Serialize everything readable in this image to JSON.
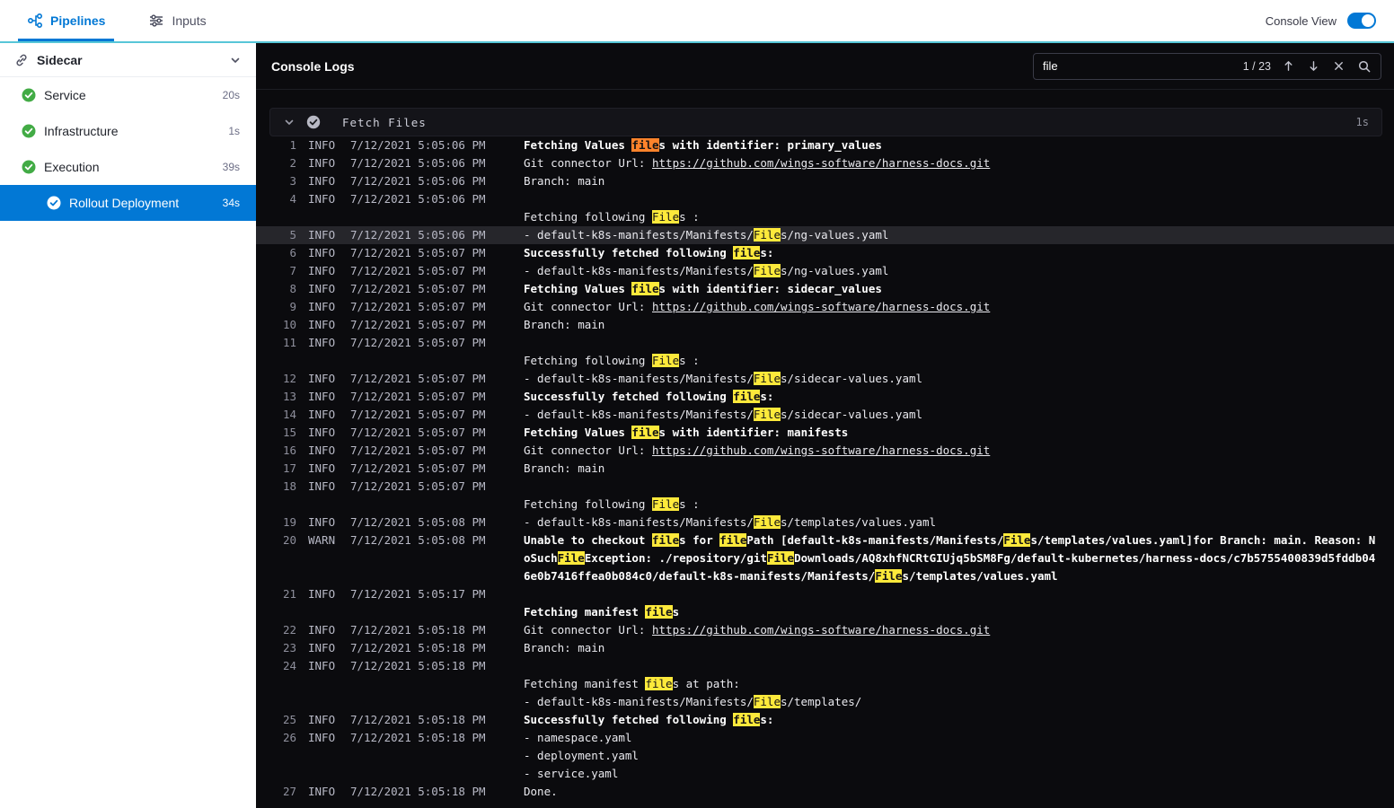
{
  "topbar": {
    "tabs": [
      {
        "label": "Pipelines",
        "active": true
      },
      {
        "label": "Inputs",
        "active": false
      }
    ],
    "console_view_label": "Console View",
    "console_view_on": true
  },
  "sidebar": {
    "stage": {
      "label": "Sidecar"
    },
    "items": [
      {
        "label": "Service",
        "duration": "20s",
        "status": "success",
        "selected": false,
        "child": false
      },
      {
        "label": "Infrastructure",
        "duration": "1s",
        "status": "success",
        "selected": false,
        "child": false
      },
      {
        "label": "Execution",
        "duration": "39s",
        "status": "success",
        "selected": false,
        "child": false
      },
      {
        "label": "Rollout Deployment",
        "duration": "34s",
        "status": "success",
        "selected": true,
        "child": true
      }
    ]
  },
  "console": {
    "title": "Console Logs",
    "search": {
      "term": "file",
      "count_label": "1 / 23"
    },
    "section": {
      "title": "Fetch Files",
      "duration": "1s"
    },
    "lines": [
      {
        "num": "1",
        "level": "INFO",
        "time": "7/12/2021 5:05:06 PM",
        "text": "Fetching Values files with identifier: primary_values",
        "bold": true
      },
      {
        "num": "2",
        "level": "INFO",
        "time": "7/12/2021 5:05:06 PM",
        "text": "Git connector Url: https://github.com/wings-software/harness-docs.git"
      },
      {
        "num": "3",
        "level": "INFO",
        "time": "7/12/2021 5:05:06 PM",
        "text": "Branch: main"
      },
      {
        "num": "4",
        "level": "INFO",
        "time": "7/12/2021 5:05:06 PM",
        "text": ""
      },
      {
        "num": "",
        "level": "",
        "time": "",
        "text": "Fetching following Files :"
      },
      {
        "num": "5",
        "level": "INFO",
        "time": "7/12/2021 5:05:06 PM",
        "text": "- default-k8s-manifests/Manifests/Files/ng-values.yaml",
        "selected": true
      },
      {
        "num": "6",
        "level": "INFO",
        "time": "7/12/2021 5:05:07 PM",
        "text": "Successfully fetched following files:",
        "bold": true
      },
      {
        "num": "7",
        "level": "INFO",
        "time": "7/12/2021 5:05:07 PM",
        "text": "- default-k8s-manifests/Manifests/Files/ng-values.yaml"
      },
      {
        "num": "8",
        "level": "INFO",
        "time": "7/12/2021 5:05:07 PM",
        "text": "Fetching Values files with identifier: sidecar_values",
        "bold": true
      },
      {
        "num": "9",
        "level": "INFO",
        "time": "7/12/2021 5:05:07 PM",
        "text": "Git connector Url: https://github.com/wings-software/harness-docs.git"
      },
      {
        "num": "10",
        "level": "INFO",
        "time": "7/12/2021 5:05:07 PM",
        "text": "Branch: main"
      },
      {
        "num": "11",
        "level": "INFO",
        "time": "7/12/2021 5:05:07 PM",
        "text": ""
      },
      {
        "num": "",
        "level": "",
        "time": "",
        "text": "Fetching following Files :"
      },
      {
        "num": "12",
        "level": "INFO",
        "time": "7/12/2021 5:05:07 PM",
        "text": "- default-k8s-manifests/Manifests/Files/sidecar-values.yaml"
      },
      {
        "num": "13",
        "level": "INFO",
        "time": "7/12/2021 5:05:07 PM",
        "text": "Successfully fetched following files:",
        "bold": true
      },
      {
        "num": "14",
        "level": "INFO",
        "time": "7/12/2021 5:05:07 PM",
        "text": "- default-k8s-manifests/Manifests/Files/sidecar-values.yaml"
      },
      {
        "num": "15",
        "level": "INFO",
        "time": "7/12/2021 5:05:07 PM",
        "text": "Fetching Values files with identifier: manifests",
        "bold": true
      },
      {
        "num": "16",
        "level": "INFO",
        "time": "7/12/2021 5:05:07 PM",
        "text": "Git connector Url: https://github.com/wings-software/harness-docs.git"
      },
      {
        "num": "17",
        "level": "INFO",
        "time": "7/12/2021 5:05:07 PM",
        "text": "Branch: main"
      },
      {
        "num": "18",
        "level": "INFO",
        "time": "7/12/2021 5:05:07 PM",
        "text": ""
      },
      {
        "num": "",
        "level": "",
        "time": "",
        "text": "Fetching following Files :"
      },
      {
        "num": "19",
        "level": "INFO",
        "time": "7/12/2021 5:05:08 PM",
        "text": "- default-k8s-manifests/Manifests/Files/templates/values.yaml"
      },
      {
        "num": "20",
        "level": "WARN",
        "time": "7/12/2021 5:05:08 PM",
        "text": "Unable to checkout files for filePath [default-k8s-manifests/Manifests/Files/templates/values.yaml]for Branch: main. Reason: NoSuchFileException: ./repository/gitFileDownloads/AQ8xhfNCRtGIUjq5bSM8Fg/default-kubernetes/harness-docs/c7b5755400839d5fddb046e0b7416ffea0b084c0/default-k8s-manifests/Manifests/Files/templates/values.yaml",
        "bold": true
      },
      {
        "num": "21",
        "level": "INFO",
        "time": "7/12/2021 5:05:17 PM",
        "text": ""
      },
      {
        "num": "",
        "level": "",
        "time": "",
        "text": "Fetching manifest files",
        "bold": true
      },
      {
        "num": "22",
        "level": "INFO",
        "time": "7/12/2021 5:05:18 PM",
        "text": "Git connector Url: https://github.com/wings-software/harness-docs.git"
      },
      {
        "num": "23",
        "level": "INFO",
        "time": "7/12/2021 5:05:18 PM",
        "text": "Branch: main"
      },
      {
        "num": "24",
        "level": "INFO",
        "time": "7/12/2021 5:05:18 PM",
        "text": ""
      },
      {
        "num": "",
        "level": "",
        "time": "",
        "text": "Fetching manifest files at path:"
      },
      {
        "num": "",
        "level": "",
        "time": "",
        "text": "- default-k8s-manifests/Manifests/Files/templates/"
      },
      {
        "num": "25",
        "level": "INFO",
        "time": "7/12/2021 5:05:18 PM",
        "text": "Successfully fetched following files:",
        "bold": true
      },
      {
        "num": "26",
        "level": "INFO",
        "time": "7/12/2021 5:05:18 PM",
        "text": "- namespace.yaml"
      },
      {
        "num": "",
        "level": "",
        "time": "",
        "text": "- deployment.yaml"
      },
      {
        "num": "",
        "level": "",
        "time": "",
        "text": "- service.yaml"
      },
      {
        "num": "27",
        "level": "INFO",
        "time": "7/12/2021 5:05:18 PM",
        "text": "Done."
      }
    ]
  },
  "colors": {
    "accent": "#0278d5",
    "success": "#42ab45",
    "highlight": "#fde93b",
    "highlight_current": "#ff832b",
    "topbar_underline": "#57c6d8"
  }
}
